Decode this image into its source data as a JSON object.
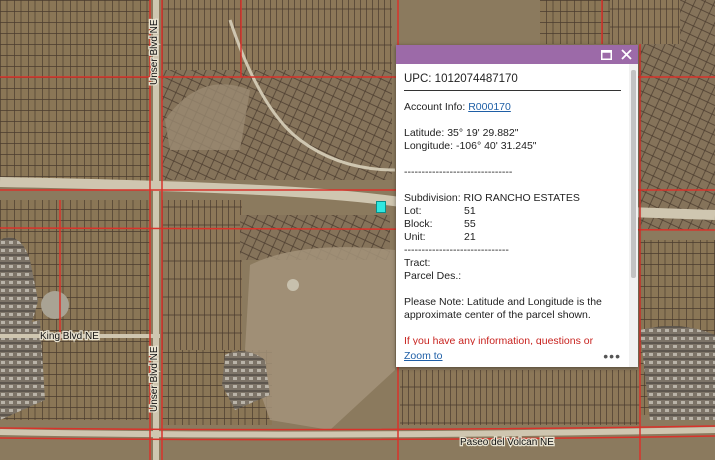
{
  "map": {
    "roads": [
      {
        "label": "Unser Blvd NE"
      },
      {
        "label": "Unser Blvd NE"
      },
      {
        "label": "King Blvd NE"
      },
      {
        "label": "Paseo del Volcan NE"
      }
    ],
    "colors": {
      "ground": "#8b7a5e",
      "parcel": "#4a3b2e",
      "boundary": "#d9322a",
      "road": "#cfc6b0"
    }
  },
  "popup": {
    "upc": "UPC: 1012074487170",
    "account_label": "Account Info: ",
    "account_link": "R000170",
    "latitude": "Latitude: 35° 19' 29.882\"",
    "longitude": "Longitude: -106° 40' 31.245\"",
    "separator1": "-------------------------------",
    "subdivision": "Subdivision: RIO RANCHO ESTATES",
    "lot_label": "Lot:",
    "lot_value": "51",
    "block_label": "Block:",
    "block_value": "55",
    "unit_label": "Unit:",
    "unit_value": "21",
    "separator2": "------------------------------",
    "tract": "Tract:",
    "parcel_des": "Parcel Des.:",
    "note": "Please Note: Latitude and Longitude is the approximate center of the parcel shown.",
    "info_note": "If you have any information, questions or",
    "zoom": "Zoom to",
    "more": "•••",
    "header_color": "#9c6aa8"
  }
}
